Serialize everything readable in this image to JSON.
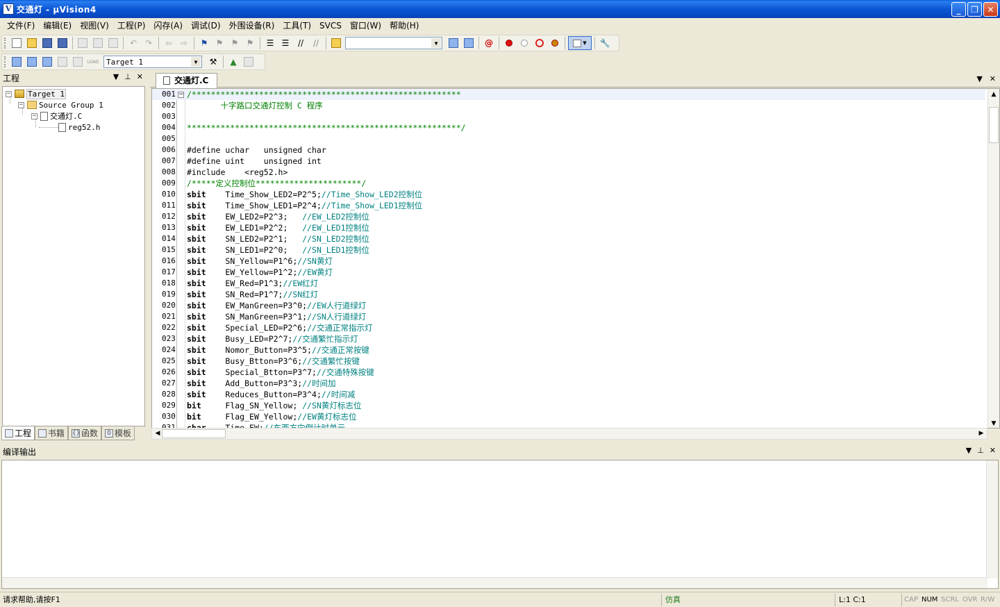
{
  "window": {
    "title": "交通灯   - µVision4",
    "icon_letter": "V"
  },
  "menu": [
    "文件(F)",
    "编辑(E)",
    "视图(V)",
    "工程(P)",
    "闪存(A)",
    "调试(D)",
    "外围设备(R)",
    "工具(T)",
    "SVCS",
    "窗口(W)",
    "帮助(H)"
  ],
  "toolbar2": {
    "target_combo": "Target 1",
    "load_label": "LOAD"
  },
  "project": {
    "header": "工程",
    "tree": {
      "target": "Target 1",
      "group": "Source Group 1",
      "file1": "交通灯.C",
      "file2": "reg52.h"
    },
    "tabs": [
      "工程",
      "书籍",
      "函数",
      "模板"
    ],
    "tab_icons": [
      "",
      "",
      "{}",
      "0"
    ]
  },
  "editor": {
    "tab_label": "交通灯.C",
    "lines": [
      {
        "n": "001",
        "text": "/********************************************************"
      },
      {
        "n": "002",
        "text": "       十字路口交通灯控制 C 程序"
      },
      {
        "n": "003",
        "text": ""
      },
      {
        "n": "004",
        "text": "*********************************************************/"
      },
      {
        "n": "005",
        "text": ""
      },
      {
        "n": "006",
        "text": "#define uchar   unsigned char"
      },
      {
        "n": "007",
        "text": "#define uint    unsigned int"
      },
      {
        "n": "008",
        "text": "#include    <reg52.h>"
      },
      {
        "n": "009",
        "text": "/*****定义控制位**********************/"
      },
      {
        "n": "010",
        "kw": "sbit",
        "text": "    Time_Show_LED2=P2^5;",
        "cm": "//Time_Show_LED2控制位"
      },
      {
        "n": "011",
        "kw": "sbit",
        "text": "    Time_Show_LED1=P2^4;",
        "cm": "//Time_Show_LED1控制位"
      },
      {
        "n": "012",
        "kw": "sbit",
        "text": "    EW_LED2=P2^3;   ",
        "cm": "//EW_LED2控制位"
      },
      {
        "n": "013",
        "kw": "sbit",
        "text": "    EW_LED1=P2^2;   ",
        "cm": "//EW_LED1控制位"
      },
      {
        "n": "014",
        "kw": "sbit",
        "text": "    SN_LED2=P2^1;   ",
        "cm": "//SN_LED2控制位"
      },
      {
        "n": "015",
        "kw": "sbit",
        "text": "    SN_LED1=P2^0;   ",
        "cm": "//SN_LED1控制位"
      },
      {
        "n": "016",
        "kw": "sbit",
        "text": "    SN_Yellow=P1^6;",
        "cm": "//SN黄灯"
      },
      {
        "n": "017",
        "kw": "sbit",
        "text": "    EW_Yellow=P1^2;",
        "cm": "//EW黄灯"
      },
      {
        "n": "018",
        "kw": "sbit",
        "text": "    EW_Red=P1^3;",
        "cm": "//EW红灯"
      },
      {
        "n": "019",
        "kw": "sbit",
        "text": "    SN_Red=P1^7;",
        "cm": "//SN红灯"
      },
      {
        "n": "020",
        "kw": "sbit",
        "text": "    EW_ManGreen=P3^0;",
        "cm": "//EW人行道绿灯"
      },
      {
        "n": "021",
        "kw": "sbit",
        "text": "    SN_ManGreen=P3^1;",
        "cm": "//SN人行道绿灯"
      },
      {
        "n": "022",
        "kw": "sbit",
        "text": "    Special_LED=P2^6;",
        "cm": "//交通正常指示灯"
      },
      {
        "n": "023",
        "kw": "sbit",
        "text": "    Busy_LED=P2^7;",
        "cm": "//交通繁忙指示灯"
      },
      {
        "n": "024",
        "kw": "sbit",
        "text": "    Nomor_Button=P3^5;",
        "cm": "//交通正常按键"
      },
      {
        "n": "025",
        "kw": "sbit",
        "text": "    Busy_Btton=P3^6;",
        "cm": "//交通繁忙按键"
      },
      {
        "n": "026",
        "kw": "sbit",
        "text": "    Special_Btton=P3^7;",
        "cm": "//交通特殊按键"
      },
      {
        "n": "027",
        "kw": "sbit",
        "text": "    Add_Button=P3^3;",
        "cm": "//时间加"
      },
      {
        "n": "028",
        "kw": "sbit",
        "text": "    Reduces_Button=P3^4;",
        "cm": "//时间减"
      },
      {
        "n": "029",
        "kw": "bit",
        "text": "     Flag_SN_Yellow; ",
        "cm": "//SN黄灯标志位"
      },
      {
        "n": "030",
        "kw": "bit",
        "text": "     Flag_EW_Yellow;",
        "cm": "//EW黄灯标志位"
      },
      {
        "n": "031",
        "kw": "char",
        "text": "    Time_EW;",
        "cm": "//东西方向倒计时单元"
      }
    ]
  },
  "output": {
    "header": "编译输出"
  },
  "status": {
    "help": "请求帮助,请按F1",
    "mode": "仿真",
    "position": "L:1 C:1",
    "flags": [
      "CAP",
      "NUM",
      "SCRL",
      "OVR",
      "R/W"
    ]
  }
}
